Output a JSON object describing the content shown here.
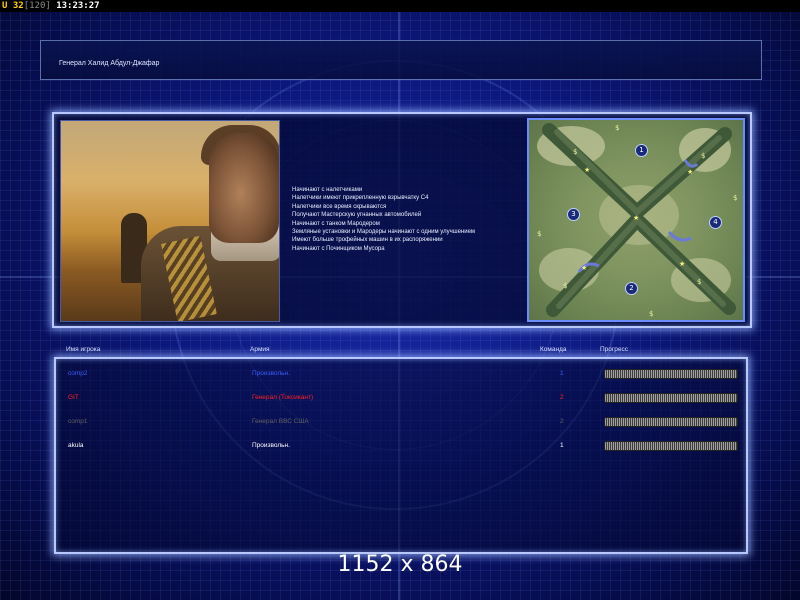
{
  "status_bar": {
    "unit_label": "U 32",
    "unit_capacity": "[120]",
    "clock": "13:23:27"
  },
  "header": {
    "general_name": "Генерал Халид Абдул-Джафар"
  },
  "briefing": {
    "portrait_icon": "general-portrait",
    "bullets": [
      "Начинают с налетчиками",
      "Налетчики имеют прикрепленную взрывчатку C4",
      "Налетчики все время скрываются",
      "Получают Мастерскую угнанных автомобилей",
      "Начинают с танком Мародером",
      "Земляные установки и Мародеры начинают с одним улучшением",
      "Имеют больше трофейных машин в их распоряжении",
      "Начинают с Починщиком Мусора"
    ],
    "map_start_positions": [
      "1",
      "2",
      "3",
      "4"
    ]
  },
  "table": {
    "headers": {
      "player": "Имя игрока",
      "army": "Армия",
      "team": "Команда",
      "progress": "Прогресс"
    },
    "rows": [
      {
        "name": "comp2",
        "army": "Произвольн.",
        "team": "1",
        "color": "#3c5cff"
      },
      {
        "name": "GIT",
        "army": "Генерал (Токсикант)",
        "team": "2",
        "color": "#ff2020"
      },
      {
        "name": "comp1",
        "army": "Генерал ВВС США",
        "team": "2",
        "color": "#606060"
      },
      {
        "name": "akula",
        "army": "Произвольн.",
        "team": "1",
        "color": "#ffffff"
      }
    ]
  },
  "overlay": {
    "resolution": "1152 x 864"
  },
  "colors": {
    "background": "#0c177a",
    "panel_border": "#b8c8ff",
    "status_yellow": "#ffd400"
  }
}
